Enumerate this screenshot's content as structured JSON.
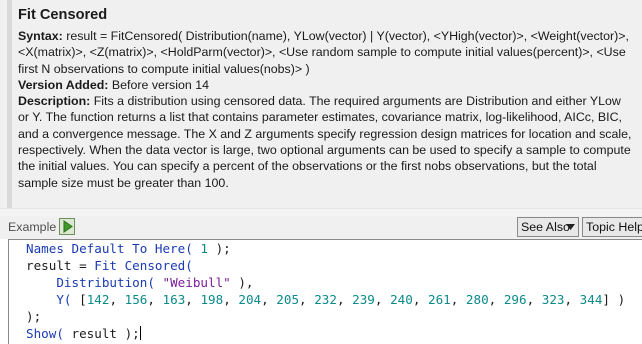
{
  "help": {
    "title": "Fit Censored",
    "syntax_label": "Syntax:",
    "syntax_text": " result = FitCensored( Distribution(name), YLow(vector) | Y(vector), <YHigh(vector)>, <Weight(vector)>, <X(matrix)>, <Z(matrix)>, <HoldParm(vector)>, <Use random sample to compute initial values(percent)>, <Use first N observations to compute initial values(nobs)> )",
    "version_label": "Version Added:",
    "version_text": " Before version 14",
    "description_label": "Description:",
    "description_text": " Fits a distribution using censored data. The required arguments are Distribution and either YLow or Y. The function returns a list that contains parameter estimates, covariance matrix, log-likelihood, AICc, BIC, and a convergence message. The X and Z arguments specify regression design matrices for location and scale, respectively. When the data vector is large, two optional arguments can be used to specify a sample to compute the initial values. You can specify a percent of the observations or the first nobs observations, but the total sample size must be greater than 100."
  },
  "example_bar": {
    "label": "Example",
    "run_icon": "run-script-icon",
    "see_also_label": "See Also",
    "see_also_arrow": "▼",
    "topic_help_label": "Topic Help"
  },
  "code": {
    "line1": {
      "kw": "Names Default To Here(",
      "num": "1",
      "rest": " );"
    },
    "line2": {
      "plain": "result = ",
      "kw": "Fit Censored("
    },
    "line3": {
      "indent": "    ",
      "kw": "Distribution(",
      "gap": " ",
      "str": "\"Weibull\"",
      "rest": " ),"
    },
    "line4": {
      "indent": "    ",
      "kw": "Y(",
      "open": " [",
      "values": [
        "142",
        "156",
        "163",
        "198",
        "204",
        "205",
        "232",
        "239",
        "240",
        "261",
        "280",
        "296",
        "323",
        "344"
      ],
      "close": "] )"
    },
    "line5": {
      "plain": ");"
    },
    "line6": {
      "kw": "Show(",
      "rest": " result );"
    }
  },
  "colors": {
    "keyword": "#1a3bb3",
    "string": "#7a1f9a",
    "number": "#0c8a8a",
    "help_background": "#f0f0f0"
  }
}
